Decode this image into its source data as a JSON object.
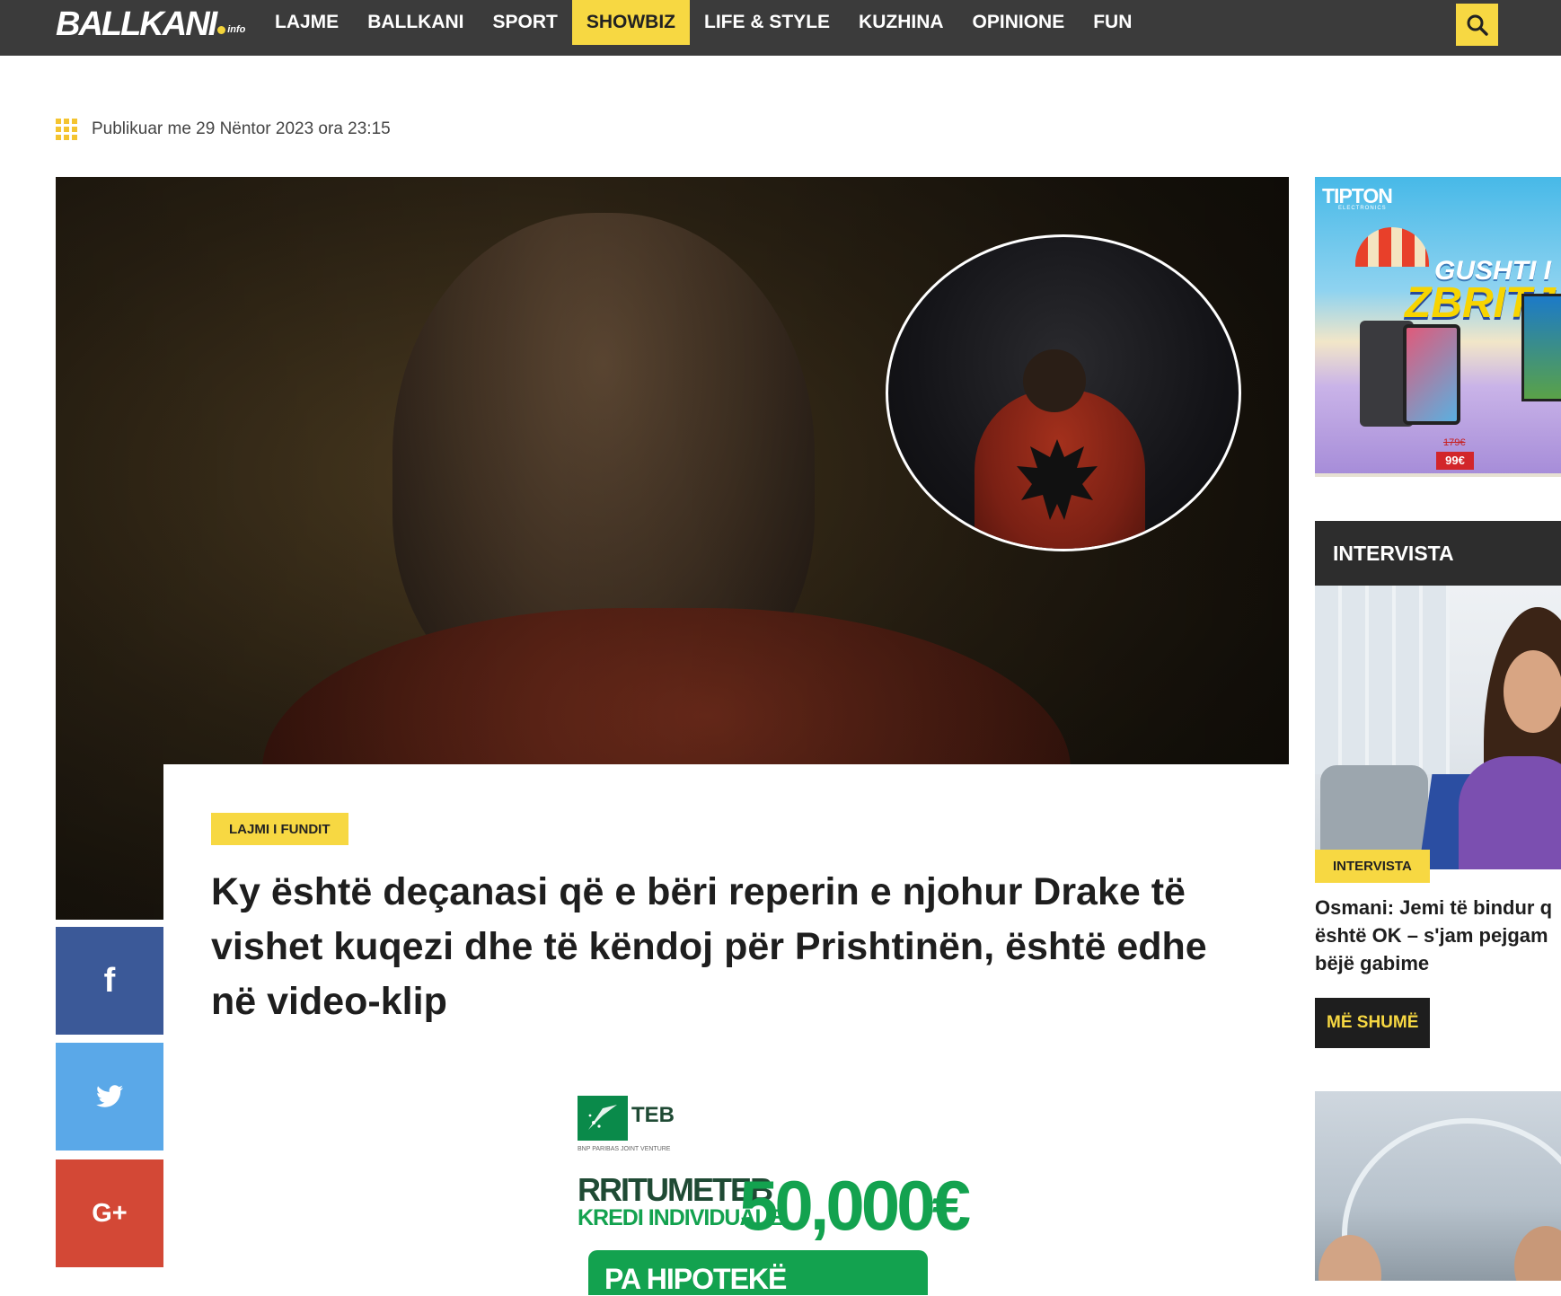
{
  "brand": {
    "logo": "BALLKANI",
    "logo_suffix": "info"
  },
  "nav": {
    "items": [
      "LAJME",
      "BALLKANI",
      "SPORT",
      "SHOWBIZ",
      "LIFE & STYLE",
      "KUZHINA",
      "OPINIONE",
      "FUN"
    ],
    "active": "SHOWBIZ"
  },
  "search": {
    "icon": "search-icon"
  },
  "article": {
    "published": "Publikuar me 29 Nëntor 2023 ora 23:15",
    "tag": "LAJMI I FUNDIT",
    "headline_lines": [
      "Ky është deçanasi që e bëri reperin e njohur Drake të",
      "vishet kuqezi dhe të këndoj për Prishtinën, është edhe",
      "në video-klip"
    ]
  },
  "share": {
    "facebook": "f",
    "google_plus": "G+"
  },
  "ad_teb": {
    "name": "TEB",
    "sub": "BNP PARIBAS JOINT VENTURE",
    "line1": "RRITUMETEB",
    "line2": "KREDI INDIVIDUALE",
    "amount": "50,000€",
    "band": "PA HIPOTEKË"
  },
  "ad_tipton": {
    "logo": "TIPTON",
    "logo_sub": "ELECTRONICS",
    "line1": "GUSHTI I",
    "line2": "ZBRITJE",
    "price_old": "179€",
    "price": "99€"
  },
  "sidebar": {
    "section_title": "INTERVISTA",
    "tag": "INTERVISTA",
    "title_lines": [
      "Osmani: Jemi të bindur q",
      "është OK – s'jam pejgam",
      "bëjë gabime"
    ],
    "more_button": "MË SHUMË"
  },
  "colors": {
    "accent": "#f7d842",
    "nav_bg": "#3b3b3b",
    "facebook": "#3b5998",
    "twitter": "#5aa8e8",
    "google_plus": "#d34836"
  }
}
